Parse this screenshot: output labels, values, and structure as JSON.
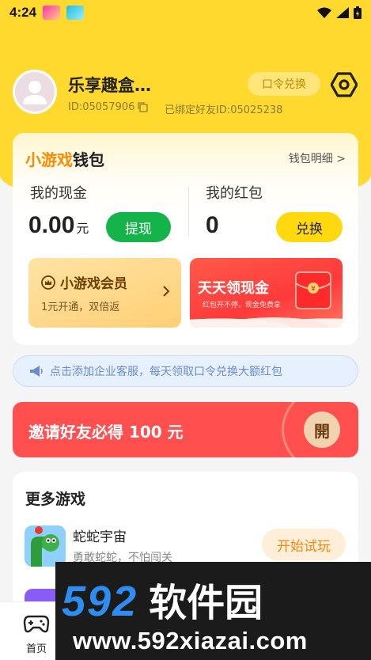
{
  "status_bar": {
    "time": "4:24"
  },
  "profile": {
    "username": "乐享趣盒…",
    "user_id": "ID:05057906",
    "bound_friend": "已绑定好友ID:05025238",
    "redeem_label": "口令兑换"
  },
  "wallet": {
    "title_highlight": "小游戏",
    "title_rest": "钱包",
    "detail_link": "钱包明细 >",
    "cash_label": "我的现金",
    "cash_value": "0.00",
    "cash_unit": "元",
    "withdraw_label": "提现",
    "redpacket_label": "我的红包",
    "redpacket_value": "0",
    "exchange_label": "兑换",
    "vip_title": "小游戏会员",
    "vip_subtitle": "1元开通，双倍返",
    "cash_promo_title": "天天领现金",
    "cash_promo_subtitle": "红包开不停，现金免费拿"
  },
  "notice": {
    "text": "点击添加企业客服，每天领取口令兑换大额红包"
  },
  "invite": {
    "text": "邀请好友必得 100 元",
    "open_label": "開"
  },
  "games": {
    "title": "更多游戏",
    "items": [
      {
        "name": "蛇蛇宇宙",
        "desc": "勇敢蛇蛇，不怕闯关",
        "action": "开始试玩"
      }
    ]
  },
  "nav": {
    "home_label": "首页"
  },
  "watermark": {
    "logo_digits": "592",
    "logo_cn": "软件园",
    "url": "www.592xiazai.com"
  },
  "colors": {
    "brand_yellow": "#ffd92e",
    "green": "#15b44a",
    "invite_red": "#ff4f4f",
    "orange": "#ff8a00"
  }
}
